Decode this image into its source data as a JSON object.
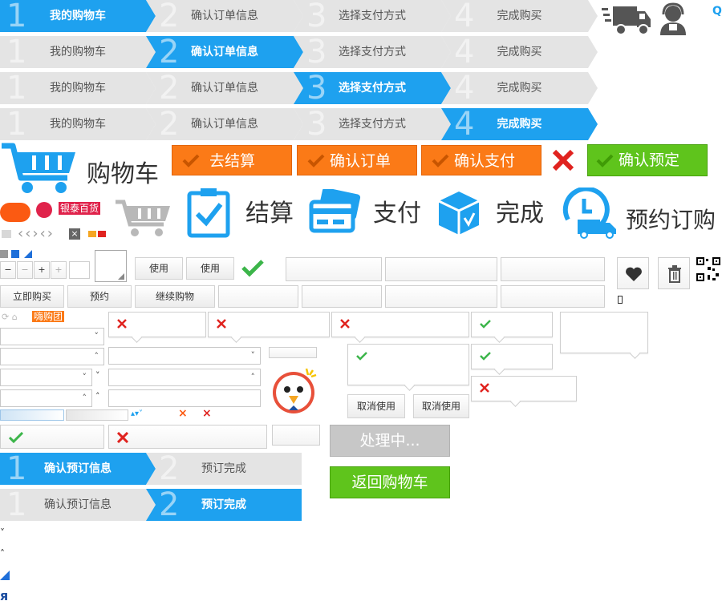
{
  "colors": {
    "blue": "#1ea1ef",
    "gray": "#e4e4e4",
    "orange": "#fb7a17",
    "green": "#5fc41c",
    "red": "#e0231f",
    "check": "#3cb54a"
  },
  "steps_rows": [
    {
      "active": 0
    },
    {
      "active": 1
    },
    {
      "active": 2
    },
    {
      "active": 3
    }
  ],
  "steps": [
    {
      "num": "1",
      "label": "我的购物车"
    },
    {
      "num": "2",
      "label": "确认订单信息"
    },
    {
      "num": "3",
      "label": "选择支付方式"
    },
    {
      "num": "4",
      "label": "完成购买"
    }
  ],
  "top_right": {
    "truck_icon": "truck-icon",
    "service_icon": "customer-service-icon",
    "corner_char": "Q"
  },
  "cart_title": "购物车",
  "orange_buttons": [
    "去结算",
    "确认订单",
    "确认支付"
  ],
  "green_button": "确认预定",
  "big_steps": [
    "结算",
    "支付",
    "完成",
    "预约订购"
  ],
  "small_tag": "银泰百货",
  "small_badge": "嗨购团",
  "stepper_symbols": [
    "−",
    "−",
    "+",
    "+"
  ],
  "use_buttons": [
    "使用",
    "使用"
  ],
  "action_buttons": [
    "立即购买",
    "预约",
    "继续购物"
  ],
  "cancel_buttons": [
    "取消使用",
    "取消使用"
  ],
  "processing_button": "处理中...",
  "back_button": "返回购物车",
  "booking_steps": [
    {
      "num": "1",
      "label": "确认预订信息"
    },
    {
      "num": "2",
      "label": "预订完成"
    }
  ],
  "booking_rows": [
    {
      "active": 0
    },
    {
      "active": 1
    }
  ],
  "bottom_glyph": "я"
}
